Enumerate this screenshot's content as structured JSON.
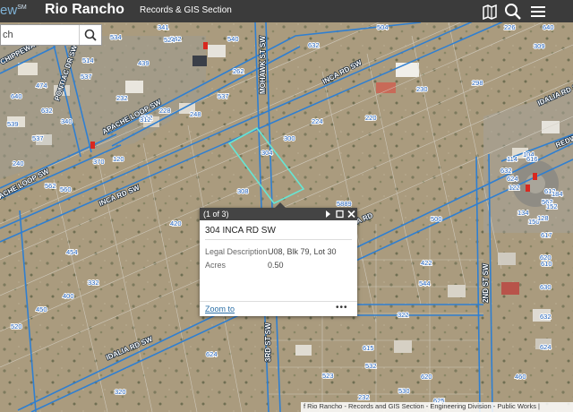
{
  "header": {
    "brand_fragment": "ew",
    "brand_mark": "SM",
    "app_title": "Rio Rancho",
    "subtitle": "Records & GIS Section",
    "icons": [
      "basemap-gallery-icon",
      "search-icon",
      "menu-icon"
    ]
  },
  "search": {
    "value": "ch",
    "placeholder": "ch"
  },
  "colors": {
    "header_bg": "#3b3b3b",
    "road_lines": "#2f7fd1",
    "selected_parcel": "#66e6d4",
    "parcel_lines": "#d6d2c8",
    "label_text": "#1f5fb8"
  },
  "streets": [
    "CHIPPEWA ST SW",
    "PONTIAC DR SW",
    "APACHE LOOP SW",
    "ACHE LOOP SW",
    "INCA RD SW",
    "INCA RD SW",
    "MOHAWK ST SW",
    "IDALIA RD SW",
    "IDALIA RD SW",
    "IDALIA RD",
    "3RD ST SW",
    "2ND ST SW",
    "REDW"
  ],
  "parcel_labels": [
    "341",
    "540",
    "632",
    "504",
    "226",
    "640",
    "534",
    "542",
    "474",
    "537",
    "439",
    "640",
    "632",
    "340",
    "514",
    "524",
    "537",
    "248",
    "232",
    "228",
    "262",
    "230",
    "298",
    "309",
    "539",
    "537",
    "552",
    "370",
    "300",
    "220",
    "224",
    "304",
    "308",
    "5889",
    "420",
    "560",
    "312",
    "120",
    "240",
    "332",
    "562",
    "454",
    "500",
    "422",
    "617",
    "610",
    "104",
    "114",
    "544",
    "322",
    "400",
    "450",
    "520",
    "615",
    "532",
    "523",
    "320",
    "624",
    "620",
    "625",
    "630",
    "632",
    "624",
    "530",
    "232",
    "460",
    "562",
    "612",
    "624",
    "632",
    "150",
    "128",
    "122",
    "134",
    "152",
    "184",
    "616",
    "620"
  ],
  "popup": {
    "count": "(1 of 3)",
    "title": "304 INCA RD SW",
    "fields": [
      {
        "label": "Legal Description",
        "value": "U08, Blk 79, Lot 30"
      },
      {
        "label": "Acres",
        "value": "0.50"
      }
    ],
    "zoom_label": "Zoom to",
    "more_label": "•••"
  },
  "attribution": "f Rio Rancho - Records and GIS Section - Engineering Division - Public Works |"
}
